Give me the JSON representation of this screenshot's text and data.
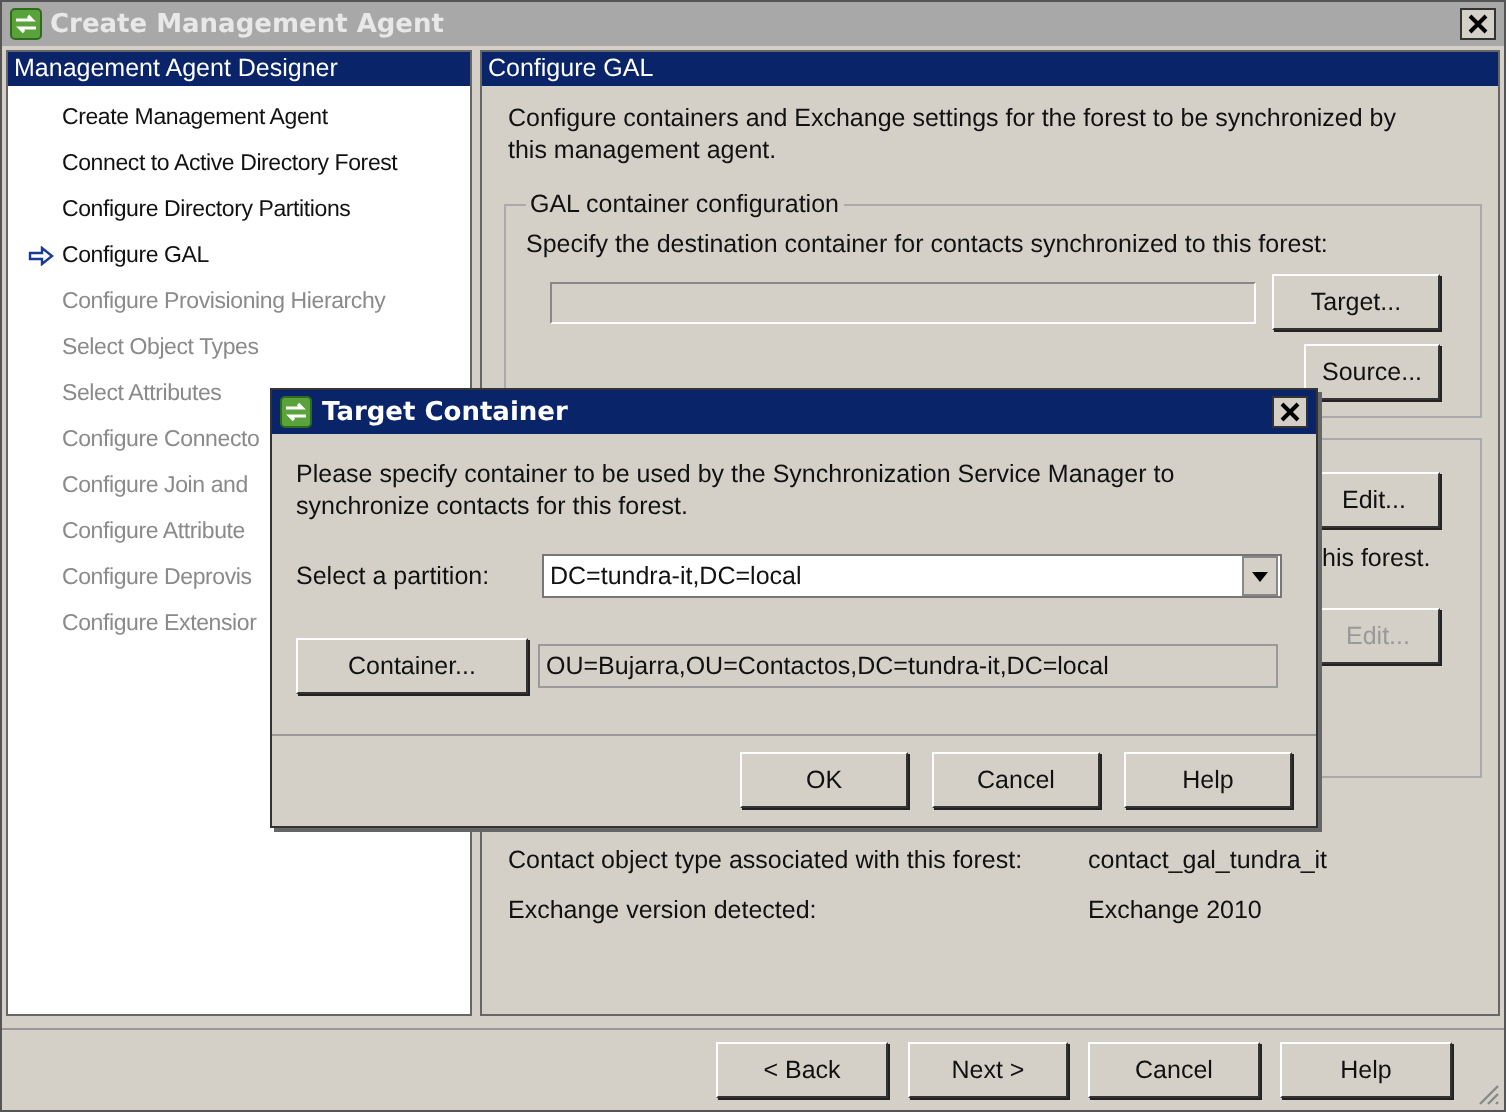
{
  "window": {
    "title": "Create Management Agent"
  },
  "sidebar": {
    "header": "Management Agent Designer",
    "items": [
      {
        "label": "Create Management Agent",
        "current": false,
        "disabled": false
      },
      {
        "label": "Connect to Active Directory Forest",
        "current": false,
        "disabled": false
      },
      {
        "label": "Configure Directory Partitions",
        "current": false,
        "disabled": false
      },
      {
        "label": "Configure GAL",
        "current": true,
        "disabled": false
      },
      {
        "label": "Configure Provisioning Hierarchy",
        "current": false,
        "disabled": true
      },
      {
        "label": "Select Object Types",
        "current": false,
        "disabled": true
      },
      {
        "label": "Select Attributes",
        "current": false,
        "disabled": true
      },
      {
        "label": "Configure Connecto",
        "current": false,
        "disabled": true
      },
      {
        "label": "Configure Join and",
        "current": false,
        "disabled": true
      },
      {
        "label": "Configure Attribute",
        "current": false,
        "disabled": true
      },
      {
        "label": "Configure Deprovis",
        "current": false,
        "disabled": true
      },
      {
        "label": "Configure Extensior",
        "current": false,
        "disabled": true
      }
    ]
  },
  "content": {
    "header": "Configure GAL",
    "description": "Configure containers and Exchange settings for the forest to be synchronized by this management agent.",
    "gal_group": {
      "legend": "GAL container configuration",
      "instruction": "Specify the destination container for contacts synchronized to this forest:",
      "target_button": "Target...",
      "source_button": "Source..."
    },
    "hidden_group": {
      "edit_button": {
        "label": "Edit...",
        "disabled": false
      },
      "text": "his forest.",
      "second_edit_button": {
        "label": "Edit...",
        "disabled": true
      }
    },
    "info": [
      {
        "label": "Contact object type associated with this forest:",
        "value": "contact_gal_tundra_it"
      },
      {
        "label": "Exchange version detected:",
        "value": "Exchange 2010"
      }
    ]
  },
  "footer_buttons": [
    "< Back",
    "Next >",
    "Cancel",
    "Help"
  ],
  "dialog": {
    "title": "Target Container",
    "message": "Please specify container to be used by the Synchronization Service Manager to synchronize contacts for this forest.",
    "partition_label": "Select a partition:",
    "partition_value": "DC=tundra-it,DC=local",
    "container_button": "Container...",
    "container_value": "OU=Bujarra,OU=Contactos,DC=tundra-it,DC=local",
    "buttons": [
      "OK",
      "Cancel",
      "Help"
    ]
  }
}
